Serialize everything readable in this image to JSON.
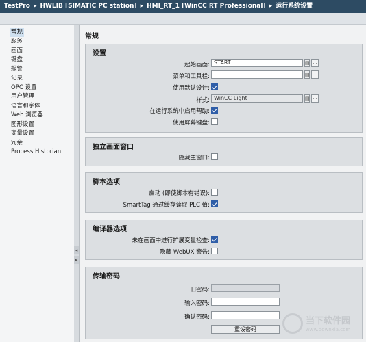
{
  "breadcrumb": [
    "TestPro",
    "HWLIB [SIMATIC PC station]",
    "HMI_RT_1 [WinCC RT Professional]",
    "运行系统设置"
  ],
  "breadcrumb_separator": "▸",
  "nav": {
    "items": [
      "常规",
      "服务",
      "画面",
      "键盘",
      "报警",
      "记录",
      "OPC 设置",
      "用户管理",
      "语言和字体",
      "Web 浏览器",
      "图形设置",
      "变量设置",
      "冗余",
      "Process Historian"
    ],
    "selected_index": 0
  },
  "main": {
    "title": "常规"
  },
  "settings": {
    "title": "设置",
    "start_screen_label": "起始画面:",
    "start_screen_value": "START",
    "menu_toolbar_label": "菜单和工具栏:",
    "menu_toolbar_value": "",
    "use_default_design_label": "使用默认设计:",
    "use_default_design_checked": true,
    "style_label": "样式:",
    "style_value": "WinCC Light",
    "enable_help_label": "在运行系统中启用帮助:",
    "enable_help_checked": true,
    "use_screen_keyboard_label": "使用屏幕键盘:",
    "use_screen_keyboard_checked": false
  },
  "independent_window": {
    "title": "独立画面窗口",
    "hide_main_window_label": "隐藏主窗口:",
    "hide_main_window_checked": false
  },
  "script_options": {
    "title": "脚本选项",
    "enable_label": "启动 (即使脚本有错误):",
    "enable_checked": false,
    "smarttag_label": "SmartTag 通过缓存读取 PLC 值:",
    "smarttag_checked": true
  },
  "compiler_options": {
    "title": "编译器选项",
    "extended_tag_check_label": "未在画面中进行扩展变量检查:",
    "extended_tag_check_checked": true,
    "hide_webux_label": "隐藏 WebUX 警告:",
    "hide_webux_checked": false
  },
  "transfer_password": {
    "title": "传输密码",
    "old_password_label": "旧密码:",
    "enter_password_label": "输入密码:",
    "confirm_password_label": "确认密码:",
    "reset_button_label": "重设密码"
  },
  "watermark": {
    "text": "当下软件园",
    "url": "www.downxia.com"
  },
  "colors": {
    "titlebar": "#2d4b63",
    "checkbox_checked": "#2f5ea8",
    "nav_selected": "#cfe0ef"
  }
}
